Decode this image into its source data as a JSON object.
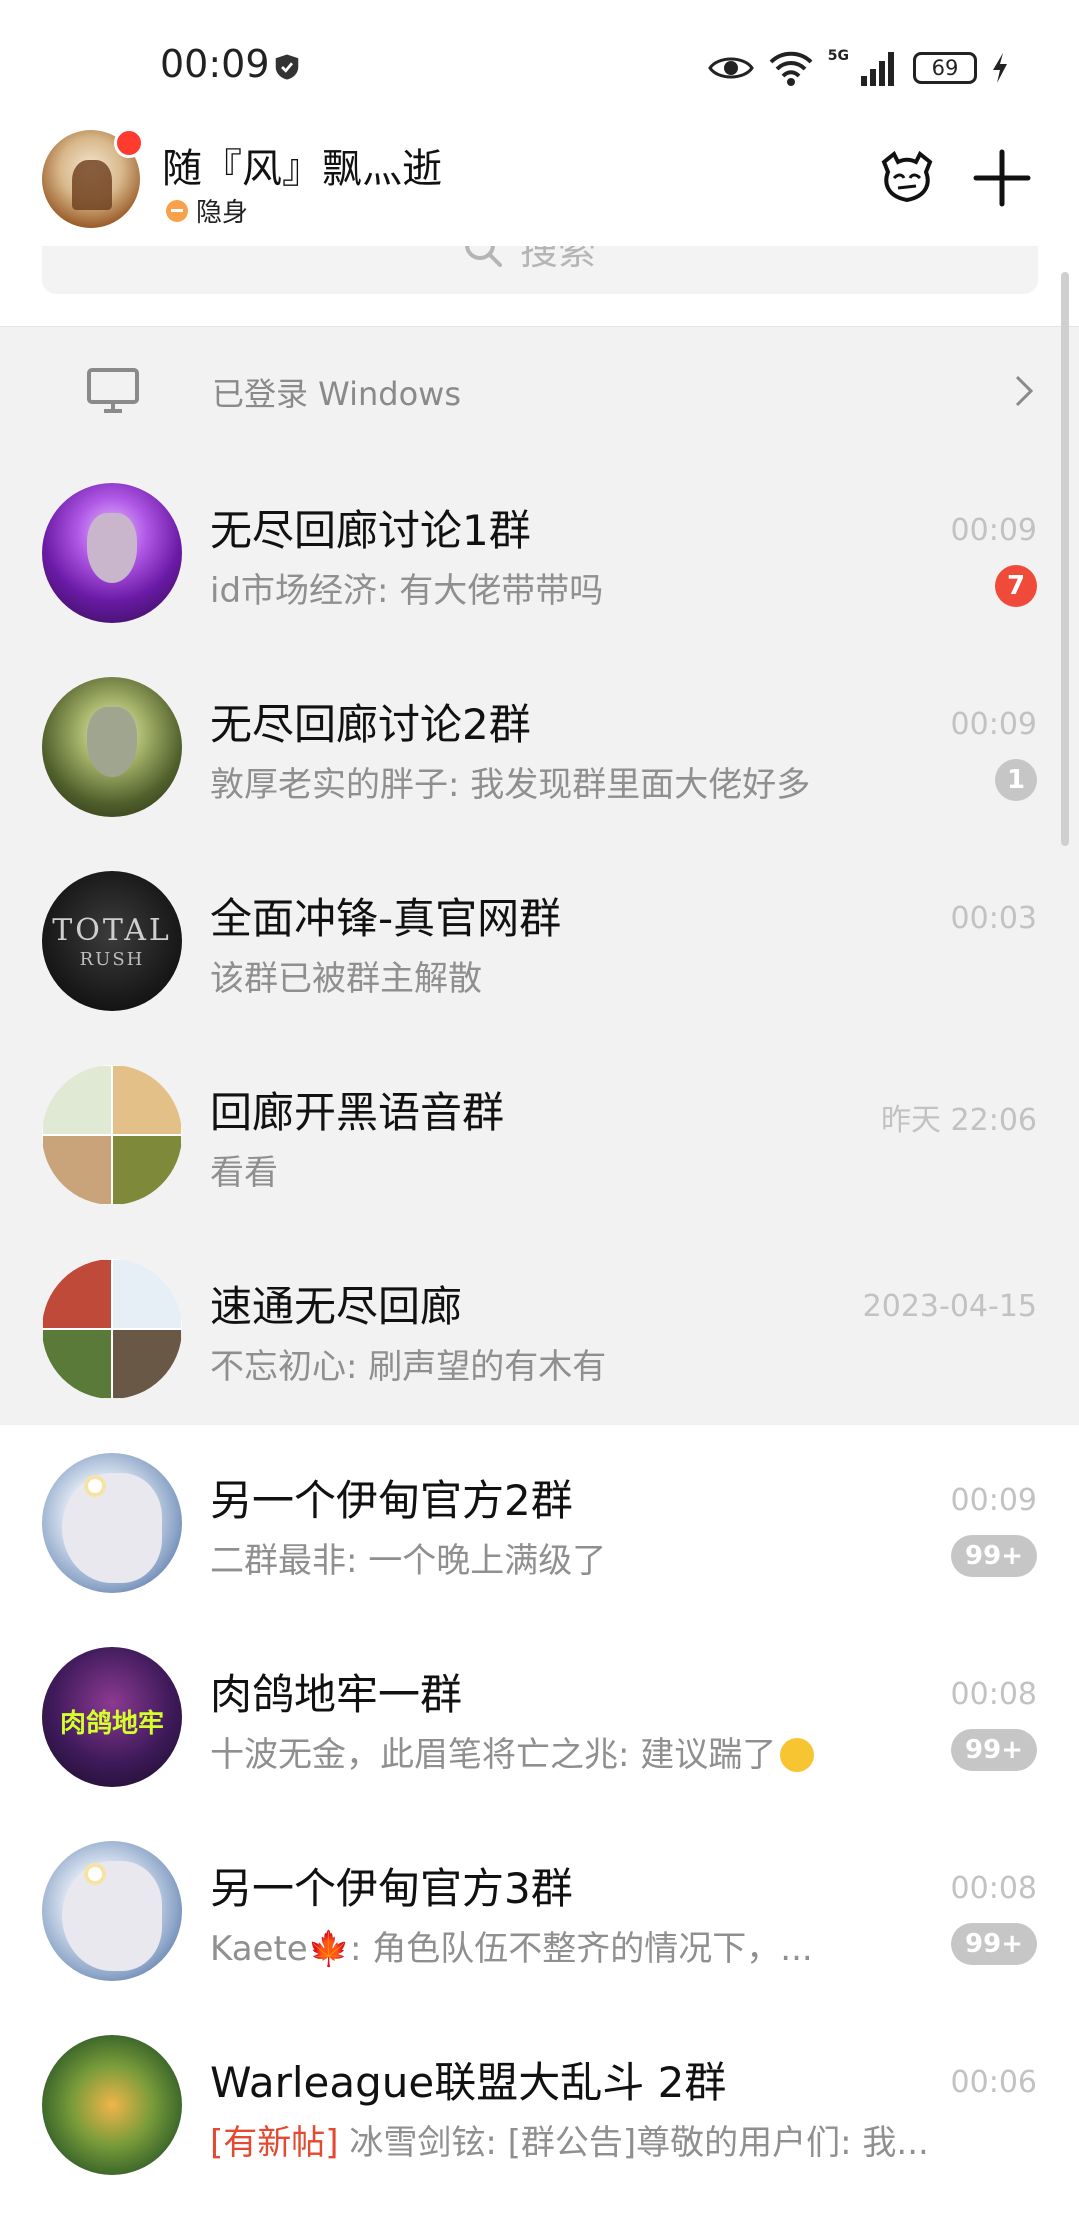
{
  "status_bar": {
    "time": "00:09",
    "network_label": "5G",
    "battery": "69"
  },
  "header": {
    "nickname": "随『风』飘灬逝",
    "status": "隐身"
  },
  "search": {
    "placeholder": "搜索"
  },
  "windows_banner": {
    "text": "已登录 Windows"
  },
  "chats": [
    {
      "name": "无尽回廊讨论1群",
      "preview": "id市场经济: 有大佬带带吗",
      "time": "00:09",
      "badge": "7",
      "badge_color": "#f04a3b",
      "pinned": true
    },
    {
      "name": "无尽回廊讨论2群",
      "preview": "敦厚老实的胖子: 我发现群里面大佬好多",
      "time": "00:09",
      "badge": "1",
      "badge_color": "#c6c6c6",
      "pinned": true
    },
    {
      "name": "全面冲锋-真官网群",
      "preview": "该群已被群主解散",
      "time": "00:03",
      "pinned": true
    },
    {
      "name": "回廊开黑语音群",
      "preview": "看看",
      "time": "昨天 22:06",
      "pinned": true
    },
    {
      "name": "速通无尽回廊",
      "preview": "不忘初心: 刷声望的有木有",
      "time": "2023-04-15",
      "pinned": true
    },
    {
      "name": "另一个伊甸官方2群",
      "preview": "二群最非: 一个晚上满级了",
      "time": "00:09",
      "badge": "99+",
      "badge_color": "#c6c6c6"
    },
    {
      "name": "肉鸽地牢一群",
      "preview": "十波无金，此眉笔将亡之兆: 建议踹了",
      "time": "00:08",
      "badge": "99+",
      "badge_color": "#c6c6c6"
    },
    {
      "name": "另一个伊甸官方3群",
      "preview": "Kaete🍁: 角色队伍不整齐的情况下，...",
      "time": "00:08",
      "badge": "99+",
      "badge_color": "#c6c6c6"
    },
    {
      "name": "Warleague联盟大乱斗 2群",
      "preview_tag": "[有新帖]",
      "preview": "冰雪剑铉: [群公告]尊敬的用户们:  我...",
      "time": "00:06"
    }
  ],
  "avatars": {
    "total_rush_line1": "TOTAL",
    "total_rush_line2": "RUSH",
    "dungeon_text": "肉鸽地牢"
  }
}
